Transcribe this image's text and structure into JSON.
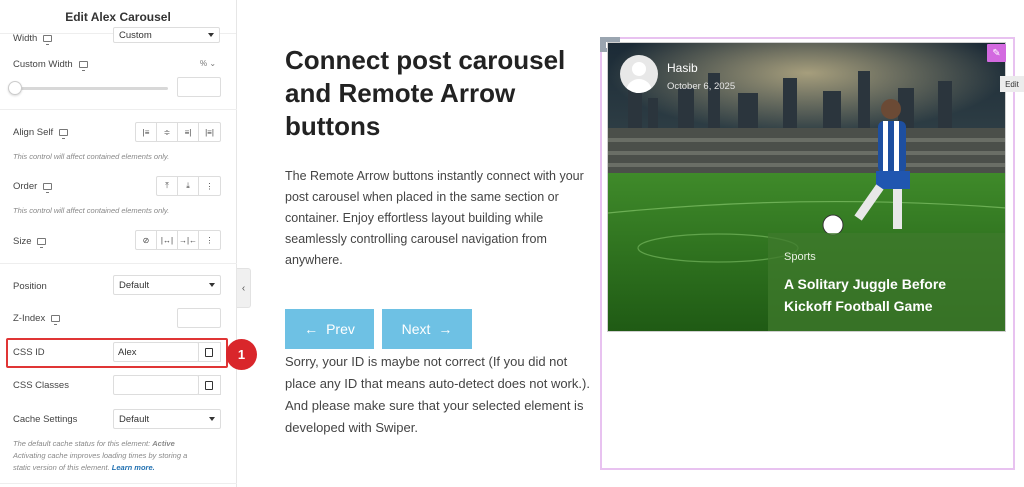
{
  "panel": {
    "title": "Edit Alex Carousel",
    "width": {
      "label": "Width",
      "value": "Custom"
    },
    "custom_width": {
      "label": "Custom Width",
      "unit": "% ⌄"
    },
    "align_self": {
      "label": "Align Self",
      "hint": "This control will affect contained elements only."
    },
    "order": {
      "label": "Order",
      "hint": "This control will affect contained elements only."
    },
    "size": {
      "label": "Size"
    },
    "position": {
      "label": "Position",
      "value": "Default"
    },
    "z_index": {
      "label": "Z-Index"
    },
    "css_id": {
      "label": "CSS ID",
      "value": "Alex"
    },
    "css_classes": {
      "label": "CSS Classes"
    },
    "cache": {
      "label": "Cache Settings",
      "value": "Default",
      "hint_pre": "The default cache status for this element: ",
      "hint_status": "Active",
      "hint_line2": "Activating cache improves loading times by storing a",
      "hint_line3": "static version of this element. ",
      "learn_more": "Learn more."
    },
    "badge": "1"
  },
  "canvas": {
    "heading": "Connect post carousel and Remote Arrow buttons",
    "description": "The Remote Arrow buttons instantly connect with your post carousel when placed in the same section or container. Enjoy effortless layout building while seamlessly controlling carousel navigation from anywhere.",
    "prev_label": "Prev",
    "next_label": "Next",
    "warning": "Sorry, your ID is maybe not correct (If you did not place any ID that means auto-detect does not work.). And please make sure that your selected element is developed with Swiper.",
    "edit_tip": "Edit"
  },
  "post_card": {
    "author": "Hasib",
    "date": "October 6, 2025",
    "category": "Sports",
    "title": "A Solitary Juggle Before Kickoff Football Game"
  },
  "colors": {
    "accent_blue": "#6ec1e4",
    "highlight_red": "#e03535",
    "badge_red": "#d9262b",
    "edit_purple": "#d36ae0"
  }
}
